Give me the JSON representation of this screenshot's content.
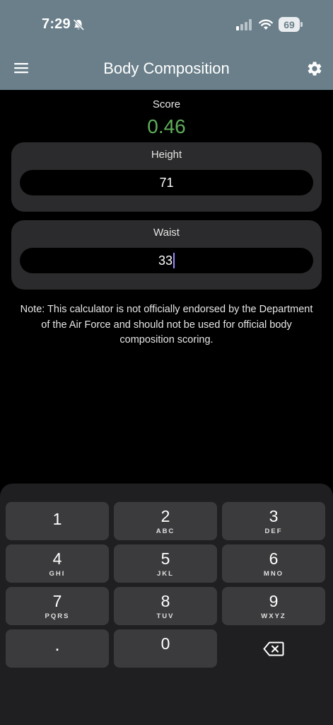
{
  "status_bar": {
    "time": "7:29",
    "battery": "69"
  },
  "app_bar": {
    "title": "Body Composition",
    "menu_icon": "menu-icon",
    "settings_icon": "gear-icon"
  },
  "score": {
    "label": "Score",
    "value": "0.46",
    "color": "#5fae5b"
  },
  "fields": {
    "height": {
      "label": "Height",
      "value": "71"
    },
    "waist": {
      "label": "Waist",
      "value": "33"
    }
  },
  "note": "Note: This calculator is not officially endorsed by the Department of the Air Force and should not be used for official body composition scoring.",
  "keypad": {
    "keys": [
      {
        "digit": "1",
        "letters": ""
      },
      {
        "digit": "2",
        "letters": "ABC"
      },
      {
        "digit": "3",
        "letters": "DEF"
      },
      {
        "digit": "4",
        "letters": "GHI"
      },
      {
        "digit": "5",
        "letters": "JKL"
      },
      {
        "digit": "6",
        "letters": "MNO"
      },
      {
        "digit": "7",
        "letters": "PQRS"
      },
      {
        "digit": "8",
        "letters": "TUV"
      },
      {
        "digit": "9",
        "letters": "WXYZ"
      },
      {
        "digit": ".",
        "letters": ""
      },
      {
        "digit": "0",
        "letters": ""
      }
    ],
    "delete_icon": "backspace-icon"
  }
}
